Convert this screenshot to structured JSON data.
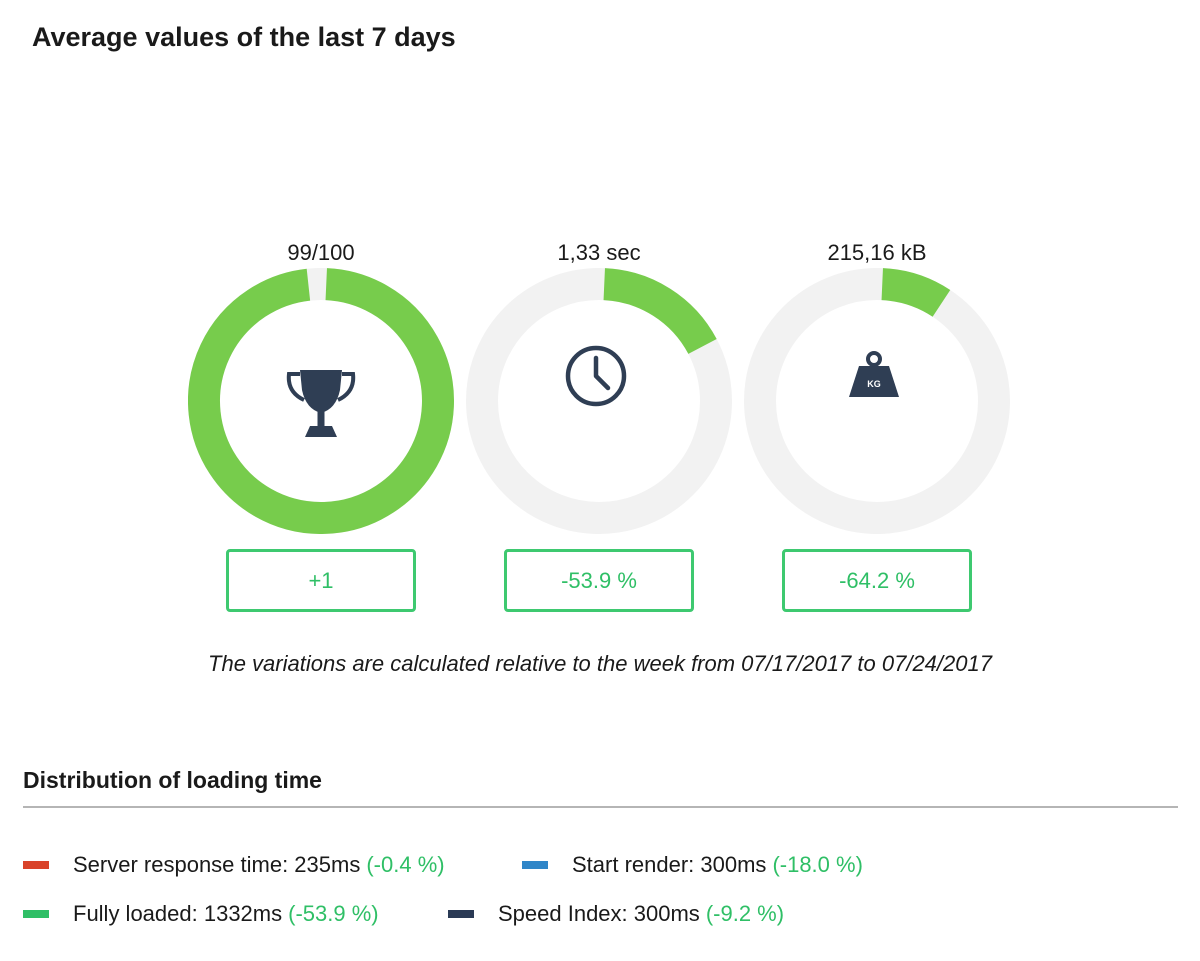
{
  "page_title": "Average values of the last 7 days",
  "colors": {
    "accent_green": "#77cc4c",
    "track_gray": "#f2f2f2",
    "icon_navy": "#2f3e54",
    "positive_text": "#2fbf66",
    "server_response": "#d9432a",
    "start_render": "#2f86c8",
    "fully_loaded": "#2fbf66",
    "speed_index": "#2a3a55"
  },
  "gauges": [
    {
      "value_label": "99/100",
      "fraction": 0.99,
      "icon": "trophy-icon",
      "variation": "+1"
    },
    {
      "value_label": "1,33 sec",
      "fraction": 0.18,
      "icon": "clock-icon",
      "variation": "-53.9 %"
    },
    {
      "value_label": "215,16 kB",
      "fraction": 0.1,
      "icon": "weight-icon",
      "icon_text": "KG",
      "variation": "-64.2 %"
    }
  ],
  "note": "The variations are calculated relative to the week from 07/17/2017 to 07/24/2017",
  "distribution": {
    "title": "Distribution of loading time",
    "legend": [
      {
        "label": "Server response time: 235ms",
        "change": "(-0.4 %)",
        "color": "#d9432a"
      },
      {
        "label": "Start render: 300ms",
        "change": "(-18.0 %)",
        "color": "#2f86c8"
      },
      {
        "label": "Fully loaded: 1332ms",
        "change": "(-53.9 %)",
        "color": "#2fbf66"
      },
      {
        "label": "Speed Index: 300ms",
        "change": "(-9.2 %)",
        "color": "#2a3a55"
      }
    ]
  }
}
